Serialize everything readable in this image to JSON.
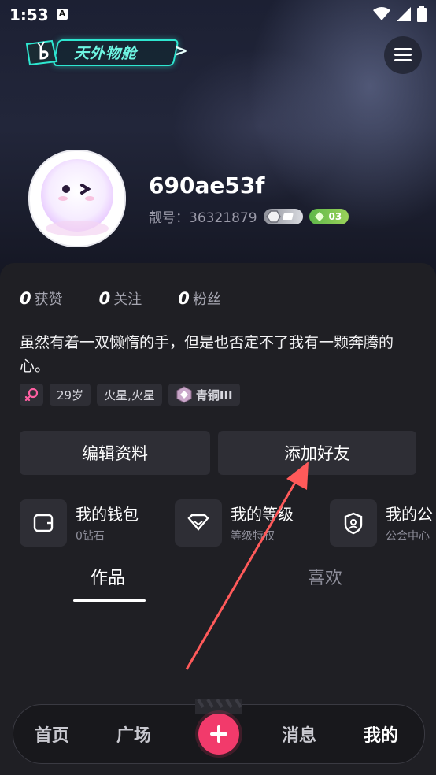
{
  "status_bar": {
    "time": "1:53",
    "notif_icon": "A"
  },
  "top_badge": {
    "label": "天外物舱",
    "chevron": ">"
  },
  "profile": {
    "username": "690ae53f",
    "account_id_text": "靓号：36321879",
    "level_badge_number": "03"
  },
  "stats": [
    {
      "num": "0",
      "label": "获赞"
    },
    {
      "num": "0",
      "label": "关注"
    },
    {
      "num": "0",
      "label": "粉丝"
    }
  ],
  "bio": "虽然有着一双懒惰的手，但是也否定不了我有一颗奔腾的心。",
  "tags": {
    "age": "29岁",
    "zodiac": "火星,火星",
    "rank": "青铜III"
  },
  "buttons": {
    "edit_profile": "编辑资料",
    "add_friend": "添加好友"
  },
  "quick_links": [
    {
      "title": "我的钱包",
      "sub": "0钻石",
      "icon": "wallet-icon"
    },
    {
      "title": "我的等级",
      "sub": "等级特权",
      "icon": "diamond-level-icon"
    },
    {
      "title": "我的公",
      "sub": "公会中心",
      "icon": "guild-shield-icon"
    }
  ],
  "content_tabs": {
    "works": "作品",
    "likes": "喜欢"
  },
  "bottom_nav": {
    "home": "首页",
    "plaza": "广场",
    "messages": "消息",
    "mine": "我的"
  },
  "colors": {
    "accent_pink": "#f23a6b",
    "badge_teal": "#2ee6d0",
    "badge_green": "#5fb84a",
    "arrow_red": "#ff5a5a"
  }
}
